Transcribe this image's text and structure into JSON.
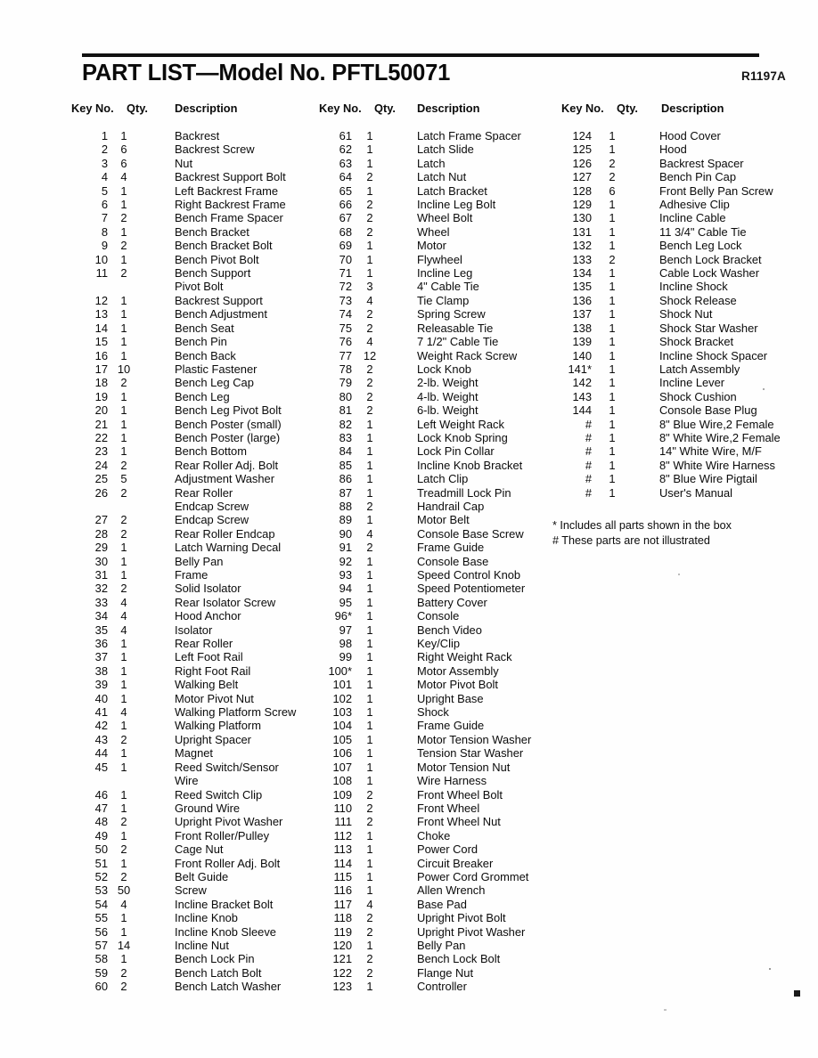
{
  "document": {
    "title": "PART LIST—Model No. PFTL50071",
    "revision": "R1197A"
  },
  "headers": {
    "key_no": "Key No.",
    "qty": "Qty.",
    "description": "Description"
  },
  "footnotes": [
    "*  Includes all parts shown in the box",
    "#  These parts are not illustrated"
  ],
  "columns": [
    {
      "id": "column-1",
      "rows": [
        {
          "key": "1",
          "qty": "1",
          "desc": "Backrest"
        },
        {
          "key": "2",
          "qty": "6",
          "desc": "Backrest Screw"
        },
        {
          "key": "3",
          "qty": "6",
          "desc": "Nut"
        },
        {
          "key": "4",
          "qty": "4",
          "desc": "Backrest Support Bolt"
        },
        {
          "key": "5",
          "qty": "1",
          "desc": "Left Backrest Frame"
        },
        {
          "key": "6",
          "qty": "1",
          "desc": "Right Backrest Frame"
        },
        {
          "key": "7",
          "qty": "2",
          "desc": "Bench Frame Spacer"
        },
        {
          "key": "8",
          "qty": "1",
          "desc": "Bench Bracket"
        },
        {
          "key": "9",
          "qty": "2",
          "desc": "Bench Bracket Bolt"
        },
        {
          "key": "10",
          "qty": "1",
          "desc": "Bench Pivot Bolt"
        },
        {
          "key": "11",
          "qty": "2",
          "desc": "Bench Support"
        },
        {
          "key": "",
          "qty": "",
          "desc": "Pivot Bolt",
          "continuation": true
        },
        {
          "key": "12",
          "qty": "1",
          "desc": "Backrest Support"
        },
        {
          "key": "13",
          "qty": "1",
          "desc": "Bench Adjustment"
        },
        {
          "key": "14",
          "qty": "1",
          "desc": "Bench Seat"
        },
        {
          "key": "15",
          "qty": "1",
          "desc": "Bench Pin"
        },
        {
          "key": "16",
          "qty": "1",
          "desc": "Bench Back"
        },
        {
          "key": "17",
          "qty": "10",
          "desc": "Plastic Fastener"
        },
        {
          "key": "18",
          "qty": "2",
          "desc": "Bench Leg Cap"
        },
        {
          "key": "19",
          "qty": "1",
          "desc": "Bench Leg"
        },
        {
          "key": "20",
          "qty": "1",
          "desc": "Bench Leg Pivot Bolt"
        },
        {
          "key": "21",
          "qty": "1",
          "desc": "Bench Poster (small)"
        },
        {
          "key": "22",
          "qty": "1",
          "desc": "Bench Poster (large)"
        },
        {
          "key": "23",
          "qty": "1",
          "desc": "Bench Bottom"
        },
        {
          "key": "24",
          "qty": "2",
          "desc": "Rear Roller Adj. Bolt"
        },
        {
          "key": "25",
          "qty": "5",
          "desc": "Adjustment Washer"
        },
        {
          "key": "26",
          "qty": "2",
          "desc": "Rear Roller"
        },
        {
          "key": "",
          "qty": "",
          "desc": "Endcap Screw",
          "continuation": true
        },
        {
          "key": "27",
          "qty": "2",
          "desc": "Endcap Screw"
        },
        {
          "key": "28",
          "qty": "2",
          "desc": "Rear Roller Endcap"
        },
        {
          "key": "29",
          "qty": "1",
          "desc": "Latch Warning Decal"
        },
        {
          "key": "30",
          "qty": "1",
          "desc": "Belly Pan"
        },
        {
          "key": "31",
          "qty": "1",
          "desc": "Frame"
        },
        {
          "key": "32",
          "qty": "2",
          "desc": "Solid Isolator"
        },
        {
          "key": "33",
          "qty": "4",
          "desc": "Rear Isolator Screw"
        },
        {
          "key": "34",
          "qty": "4",
          "desc": "Hood Anchor"
        },
        {
          "key": "35",
          "qty": "4",
          "desc": "Isolator"
        },
        {
          "key": "36",
          "qty": "1",
          "desc": "Rear Roller"
        },
        {
          "key": "37",
          "qty": "1",
          "desc": "Left Foot Rail"
        },
        {
          "key": "38",
          "qty": "1",
          "desc": "Right Foot Rail"
        },
        {
          "key": "39",
          "qty": "1",
          "desc": "Walking Belt"
        },
        {
          "key": "40",
          "qty": "1",
          "desc": "Motor Pivot Nut"
        },
        {
          "key": "41",
          "qty": "4",
          "desc": "Walking Platform Screw"
        },
        {
          "key": "42",
          "qty": "1",
          "desc": "Walking Platform"
        },
        {
          "key": "43",
          "qty": "2",
          "desc": "Upright Spacer"
        },
        {
          "key": "44",
          "qty": "1",
          "desc": "Magnet"
        },
        {
          "key": "45",
          "qty": "1",
          "desc": "Reed Switch/Sensor"
        },
        {
          "key": "",
          "qty": "",
          "desc": "Wire",
          "continuation": true
        },
        {
          "key": "46",
          "qty": "1",
          "desc": "Reed Switch Clip"
        },
        {
          "key": "47",
          "qty": "1",
          "desc": "Ground Wire"
        },
        {
          "key": "48",
          "qty": "2",
          "desc": "Upright Pivot Washer"
        },
        {
          "key": "49",
          "qty": "1",
          "desc": "Front Roller/Pulley"
        },
        {
          "key": "50",
          "qty": "2",
          "desc": "Cage Nut"
        },
        {
          "key": "51",
          "qty": "1",
          "desc": "Front Roller Adj. Bolt"
        },
        {
          "key": "52",
          "qty": "2",
          "desc": "Belt Guide"
        },
        {
          "key": "53",
          "qty": "50",
          "desc": "Screw"
        },
        {
          "key": "54",
          "qty": "4",
          "desc": "Incline Bracket Bolt"
        },
        {
          "key": "55",
          "qty": "1",
          "desc": "Incline Knob"
        },
        {
          "key": "56",
          "qty": "1",
          "desc": "Incline Knob Sleeve"
        },
        {
          "key": "57",
          "qty": "14",
          "desc": "Incline Nut"
        },
        {
          "key": "58",
          "qty": "1",
          "desc": "Bench Lock Pin"
        },
        {
          "key": "59",
          "qty": "2",
          "desc": "Bench Latch Bolt"
        },
        {
          "key": "60",
          "qty": "2",
          "desc": "Bench Latch Washer"
        }
      ]
    },
    {
      "id": "column-2",
      "rows": [
        {
          "key": "61",
          "qty": "1",
          "desc": "Latch Frame Spacer"
        },
        {
          "key": "62",
          "qty": "1",
          "desc": "Latch Slide"
        },
        {
          "key": "63",
          "qty": "1",
          "desc": "Latch"
        },
        {
          "key": "64",
          "qty": "2",
          "desc": "Latch Nut"
        },
        {
          "key": "65",
          "qty": "1",
          "desc": "Latch Bracket"
        },
        {
          "key": "66",
          "qty": "2",
          "desc": "Incline Leg Bolt"
        },
        {
          "key": "67",
          "qty": "2",
          "desc": "Wheel Bolt"
        },
        {
          "key": "68",
          "qty": "2",
          "desc": "Wheel"
        },
        {
          "key": "69",
          "qty": "1",
          "desc": "Motor"
        },
        {
          "key": "70",
          "qty": "1",
          "desc": "Flywheel"
        },
        {
          "key": "71",
          "qty": "1",
          "desc": "Incline Leg"
        },
        {
          "key": "72",
          "qty": "3",
          "desc": "4\" Cable Tie"
        },
        {
          "key": "73",
          "qty": "4",
          "desc": "Tie Clamp"
        },
        {
          "key": "74",
          "qty": "2",
          "desc": "Spring Screw"
        },
        {
          "key": "75",
          "qty": "2",
          "desc": "Releasable Tie"
        },
        {
          "key": "76",
          "qty": "4",
          "desc": "7 1/2\" Cable Tie"
        },
        {
          "key": "77",
          "qty": "12",
          "desc": "Weight Rack Screw"
        },
        {
          "key": "78",
          "qty": "2",
          "desc": "Lock Knob"
        },
        {
          "key": "79",
          "qty": "2",
          "desc": "2-lb. Weight"
        },
        {
          "key": "80",
          "qty": "2",
          "desc": "4-lb. Weight"
        },
        {
          "key": "81",
          "qty": "2",
          "desc": "6-lb. Weight"
        },
        {
          "key": "82",
          "qty": "1",
          "desc": "Left Weight Rack"
        },
        {
          "key": "83",
          "qty": "1",
          "desc": "Lock Knob Spring"
        },
        {
          "key": "84",
          "qty": "1",
          "desc": "Lock Pin Collar"
        },
        {
          "key": "85",
          "qty": "1",
          "desc": "Incline Knob Bracket"
        },
        {
          "key": "86",
          "qty": "1",
          "desc": "Latch Clip"
        },
        {
          "key": "87",
          "qty": "1",
          "desc": "Treadmill Lock Pin"
        },
        {
          "key": "88",
          "qty": "2",
          "desc": "Handrail Cap"
        },
        {
          "key": "89",
          "qty": "1",
          "desc": "Motor Belt"
        },
        {
          "key": "90",
          "qty": "4",
          "desc": "Console Base Screw"
        },
        {
          "key": "91",
          "qty": "2",
          "desc": "Frame Guide"
        },
        {
          "key": "92",
          "qty": "1",
          "desc": "Console Base"
        },
        {
          "key": "93",
          "qty": "1",
          "desc": "Speed Control Knob"
        },
        {
          "key": "94",
          "qty": "1",
          "desc": "Speed Potentiometer"
        },
        {
          "key": "95",
          "qty": "1",
          "desc": "Battery Cover"
        },
        {
          "key": "96*",
          "qty": "1",
          "desc": "Console"
        },
        {
          "key": "97",
          "qty": "1",
          "desc": "Bench Video"
        },
        {
          "key": "98",
          "qty": "1",
          "desc": "Key/Clip"
        },
        {
          "key": "99",
          "qty": "1",
          "desc": "Right Weight Rack"
        },
        {
          "key": "100*",
          "qty": "1",
          "desc": "Motor Assembly"
        },
        {
          "key": "101",
          "qty": "1",
          "desc": "Motor Pivot Bolt"
        },
        {
          "key": "102",
          "qty": "1",
          "desc": "Upright Base"
        },
        {
          "key": "103",
          "qty": "1",
          "desc": "Shock"
        },
        {
          "key": "104",
          "qty": "1",
          "desc": "Frame Guide"
        },
        {
          "key": "105",
          "qty": "1",
          "desc": "Motor Tension Washer"
        },
        {
          "key": "106",
          "qty": "1",
          "desc": "Tension Star Washer"
        },
        {
          "key": "107",
          "qty": "1",
          "desc": "Motor Tension Nut"
        },
        {
          "key": "108",
          "qty": "1",
          "desc": "Wire Harness"
        },
        {
          "key": "109",
          "qty": "2",
          "desc": "Front Wheel Bolt"
        },
        {
          "key": "110",
          "qty": "2",
          "desc": "Front Wheel"
        },
        {
          "key": "111",
          "qty": "2",
          "desc": "Front Wheel Nut"
        },
        {
          "key": "112",
          "qty": "1",
          "desc": "Choke"
        },
        {
          "key": "113",
          "qty": "1",
          "desc": "Power Cord"
        },
        {
          "key": "114",
          "qty": "1",
          "desc": "Circuit Breaker"
        },
        {
          "key": "115",
          "qty": "1",
          "desc": "Power Cord Grommet"
        },
        {
          "key": "116",
          "qty": "1",
          "desc": "Allen Wrench"
        },
        {
          "key": "117",
          "qty": "4",
          "desc": "Base Pad"
        },
        {
          "key": "118",
          "qty": "2",
          "desc": "Upright Pivot Bolt"
        },
        {
          "key": "119",
          "qty": "2",
          "desc": "Upright Pivot Washer"
        },
        {
          "key": "120",
          "qty": "1",
          "desc": "Belly Pan"
        },
        {
          "key": "121",
          "qty": "2",
          "desc": "Bench Lock Bolt"
        },
        {
          "key": "122",
          "qty": "2",
          "desc": "Flange Nut"
        },
        {
          "key": "123",
          "qty": "1",
          "desc": "Controller"
        }
      ]
    },
    {
      "id": "column-3",
      "rows": [
        {
          "key": "124",
          "qty": "1",
          "desc": "Hood Cover"
        },
        {
          "key": "125",
          "qty": "1",
          "desc": "Hood"
        },
        {
          "key": "126",
          "qty": "2",
          "desc": "Backrest Spacer"
        },
        {
          "key": "127",
          "qty": "2",
          "desc": "Bench Pin Cap"
        },
        {
          "key": "128",
          "qty": "6",
          "desc": "Front Belly Pan Screw"
        },
        {
          "key": "129",
          "qty": "1",
          "desc": "Adhesive Clip"
        },
        {
          "key": "130",
          "qty": "1",
          "desc": "Incline Cable"
        },
        {
          "key": "131",
          "qty": "1",
          "desc": "11 3/4\" Cable Tie"
        },
        {
          "key": "132",
          "qty": "1",
          "desc": "Bench Leg Lock"
        },
        {
          "key": "133",
          "qty": "2",
          "desc": "Bench Lock Bracket"
        },
        {
          "key": "134",
          "qty": "1",
          "desc": "Cable Lock Washer"
        },
        {
          "key": "135",
          "qty": "1",
          "desc": "Incline Shock"
        },
        {
          "key": "136",
          "qty": "1",
          "desc": "Shock Release"
        },
        {
          "key": "137",
          "qty": "1",
          "desc": "Shock Nut"
        },
        {
          "key": "138",
          "qty": "1",
          "desc": "Shock Star Washer"
        },
        {
          "key": "139",
          "qty": "1",
          "desc": "Shock Bracket"
        },
        {
          "key": "140",
          "qty": "1",
          "desc": "Incline Shock Spacer"
        },
        {
          "key": "141*",
          "qty": "1",
          "desc": "Latch Assembly"
        },
        {
          "key": "142",
          "qty": "1",
          "desc": "Incline Lever"
        },
        {
          "key": "143",
          "qty": "1",
          "desc": "Shock Cushion"
        },
        {
          "key": "144",
          "qty": "1",
          "desc": "Console Base Plug"
        },
        {
          "key": "#",
          "qty": "1",
          "desc": "8\" Blue Wire,2 Female"
        },
        {
          "key": "#",
          "qty": "1",
          "desc": "8\" White Wire,2 Female"
        },
        {
          "key": "#",
          "qty": "1",
          "desc": "14\" White Wire, M/F"
        },
        {
          "key": "#",
          "qty": "1",
          "desc": "8\" White Wire Harness"
        },
        {
          "key": "#",
          "qty": "1",
          "desc": "8\" Blue Wire Pigtail"
        },
        {
          "key": "#",
          "qty": "1",
          "desc": "User's Manual"
        }
      ]
    }
  ]
}
